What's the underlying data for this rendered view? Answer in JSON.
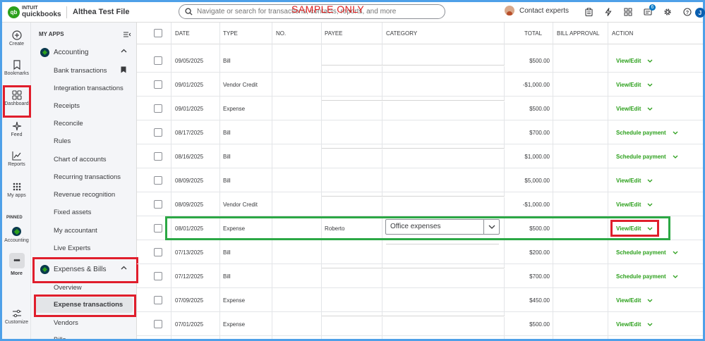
{
  "topbar": {
    "logo_top": "INTUIT",
    "logo_bottom": "quickbooks",
    "logo_mark": "qb",
    "company": "Althea Test File",
    "search_placeholder": "Navigate or search for transactions, contacts, reports, and more",
    "watermark": "SAMPLE ONLY",
    "contact_experts": "Contact experts",
    "icons": [
      "clipboard-icon",
      "lightning-icon",
      "apps-grid-icon",
      "notification-icon",
      "gear-icon",
      "help-icon"
    ],
    "notification_count": "6",
    "user_initial": "J"
  },
  "rail": {
    "create": "Create",
    "bookmarks": "Bookmarks",
    "dashboard": "Dashboard",
    "feed": "Feed",
    "reports": "Reports",
    "my_apps": "My apps",
    "pinned": "PINNED",
    "accounting": "Accounting",
    "more": "More",
    "customize": "Customize"
  },
  "nav": {
    "my_apps": "MY APPS",
    "accounting": "Accounting",
    "accounting_items": [
      "Bank transactions",
      "Integration transactions",
      "Receipts",
      "Reconcile",
      "Rules",
      "Chart of accounts",
      "Recurring transactions",
      "Revenue recognition",
      "Fixed assets",
      "My accountant",
      "Live Experts"
    ],
    "expenses_bills": "Expenses & Bills",
    "expenses_items": [
      "Overview",
      "Expense transactions",
      "Vendors",
      "Bills"
    ]
  },
  "table": {
    "headers": {
      "date": "DATE",
      "type": "TYPE",
      "no": "NO.",
      "payee": "PAYEE",
      "category": "CATEGORY",
      "total": "TOTAL",
      "bill_approval": "BILL APPROVAL",
      "action": "ACTION"
    },
    "rows": [
      {
        "date": "09/05/2025",
        "type": "Bill",
        "payee": "",
        "total": "$500.00",
        "action": "View/Edit"
      },
      {
        "date": "09/01/2025",
        "type": "Vendor Credit",
        "payee": "",
        "total": "-$1,000.00",
        "action": "View/Edit"
      },
      {
        "date": "09/01/2025",
        "type": "Expense",
        "payee": "",
        "total": "$500.00",
        "action": "View/Edit"
      },
      {
        "date": "08/17/2025",
        "type": "Bill",
        "payee": "",
        "total": "$700.00",
        "action": "Schedule payment"
      },
      {
        "date": "08/16/2025",
        "type": "Bill",
        "payee": "",
        "total": "$1,000.00",
        "action": "Schedule payment"
      },
      {
        "date": "08/09/2025",
        "type": "Bill",
        "payee": "",
        "total": "$5,000.00",
        "action": "View/Edit"
      },
      {
        "date": "08/09/2025",
        "type": "Vendor Credit",
        "payee": "",
        "total": "-$1,000.00",
        "action": "View/Edit"
      },
      {
        "date": "08/01/2025",
        "type": "Expense",
        "payee": "Roberto",
        "category": "Office expenses",
        "total": "$500.00",
        "action": "View/Edit"
      },
      {
        "date": "07/13/2025",
        "type": "Bill",
        "payee": "",
        "total": "$200.00",
        "action": "Schedule payment"
      },
      {
        "date": "07/12/2025",
        "type": "Bill",
        "payee": "",
        "total": "$700.00",
        "action": "Schedule payment"
      },
      {
        "date": "07/09/2025",
        "type": "Expense",
        "payee": "",
        "total": "$450.00",
        "action": "View/Edit"
      },
      {
        "date": "07/01/2025",
        "type": "Expense",
        "payee": "",
        "total": "$500.00",
        "action": "View/Edit"
      }
    ]
  },
  "colors": {
    "brand_green": "#2ca01c",
    "highlight_red": "#e01e2c",
    "highlight_green": "#2ca845",
    "frame_blue": "#4ea0e8"
  }
}
